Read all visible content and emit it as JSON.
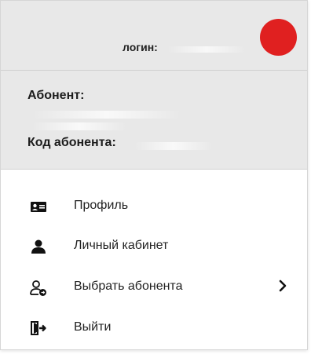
{
  "account_menu": {
    "login_label": "логин:",
    "subscriber_label": "Абонент:",
    "subscriber_code_label": "Код абонента:",
    "avatar_color": "#e02020",
    "items": [
      {
        "label": "Профиль",
        "icon": "id-card-icon"
      },
      {
        "label": "Личный кабинет",
        "icon": "user-icon"
      },
      {
        "label": "Выбрать абонента",
        "icon": "switch-user-icon",
        "has_submenu": true
      },
      {
        "label": "Выйти",
        "icon": "logout-icon"
      }
    ]
  }
}
